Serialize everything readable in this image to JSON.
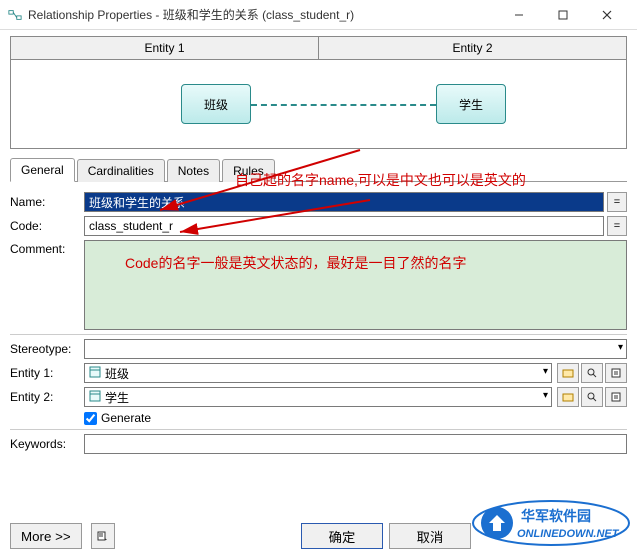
{
  "titlebar": {
    "title": "Relationship Properties - 班级和学生的关系 (class_student_r)"
  },
  "entity_panel": {
    "head1": "Entity 1",
    "head2": "Entity 2",
    "box1": "班级",
    "box2": "学生"
  },
  "annotations": {
    "name_note": "自己起的名字name,可以是中文也可以是英文的",
    "code_note": "Code的名字一般是英文状态的，最好是一目了然的名字"
  },
  "tabs": {
    "general": "General",
    "card": "Cardinalities",
    "notes": "Notes",
    "rules": "Rules"
  },
  "form": {
    "name_label": "Name:",
    "name_value": "班级和学生的关系",
    "code_label": "Code:",
    "code_value": "class_student_r",
    "comment_label": "Comment:",
    "stereotype_label": "Stereotype:",
    "stereotype_value": "",
    "entity1_label": "Entity 1:",
    "entity1_value": "班级",
    "entity2_label": "Entity 2:",
    "entity2_value": "学生",
    "generate_label": "Generate",
    "keywords_label": "Keywords:",
    "keywords_value": "",
    "eq_btn": "="
  },
  "footer": {
    "more": "More >>",
    "ok": "确定",
    "cancel": "取消"
  },
  "watermark": {
    "line1": "华军软件园",
    "line2": "ONLINEDOWN.NET"
  }
}
